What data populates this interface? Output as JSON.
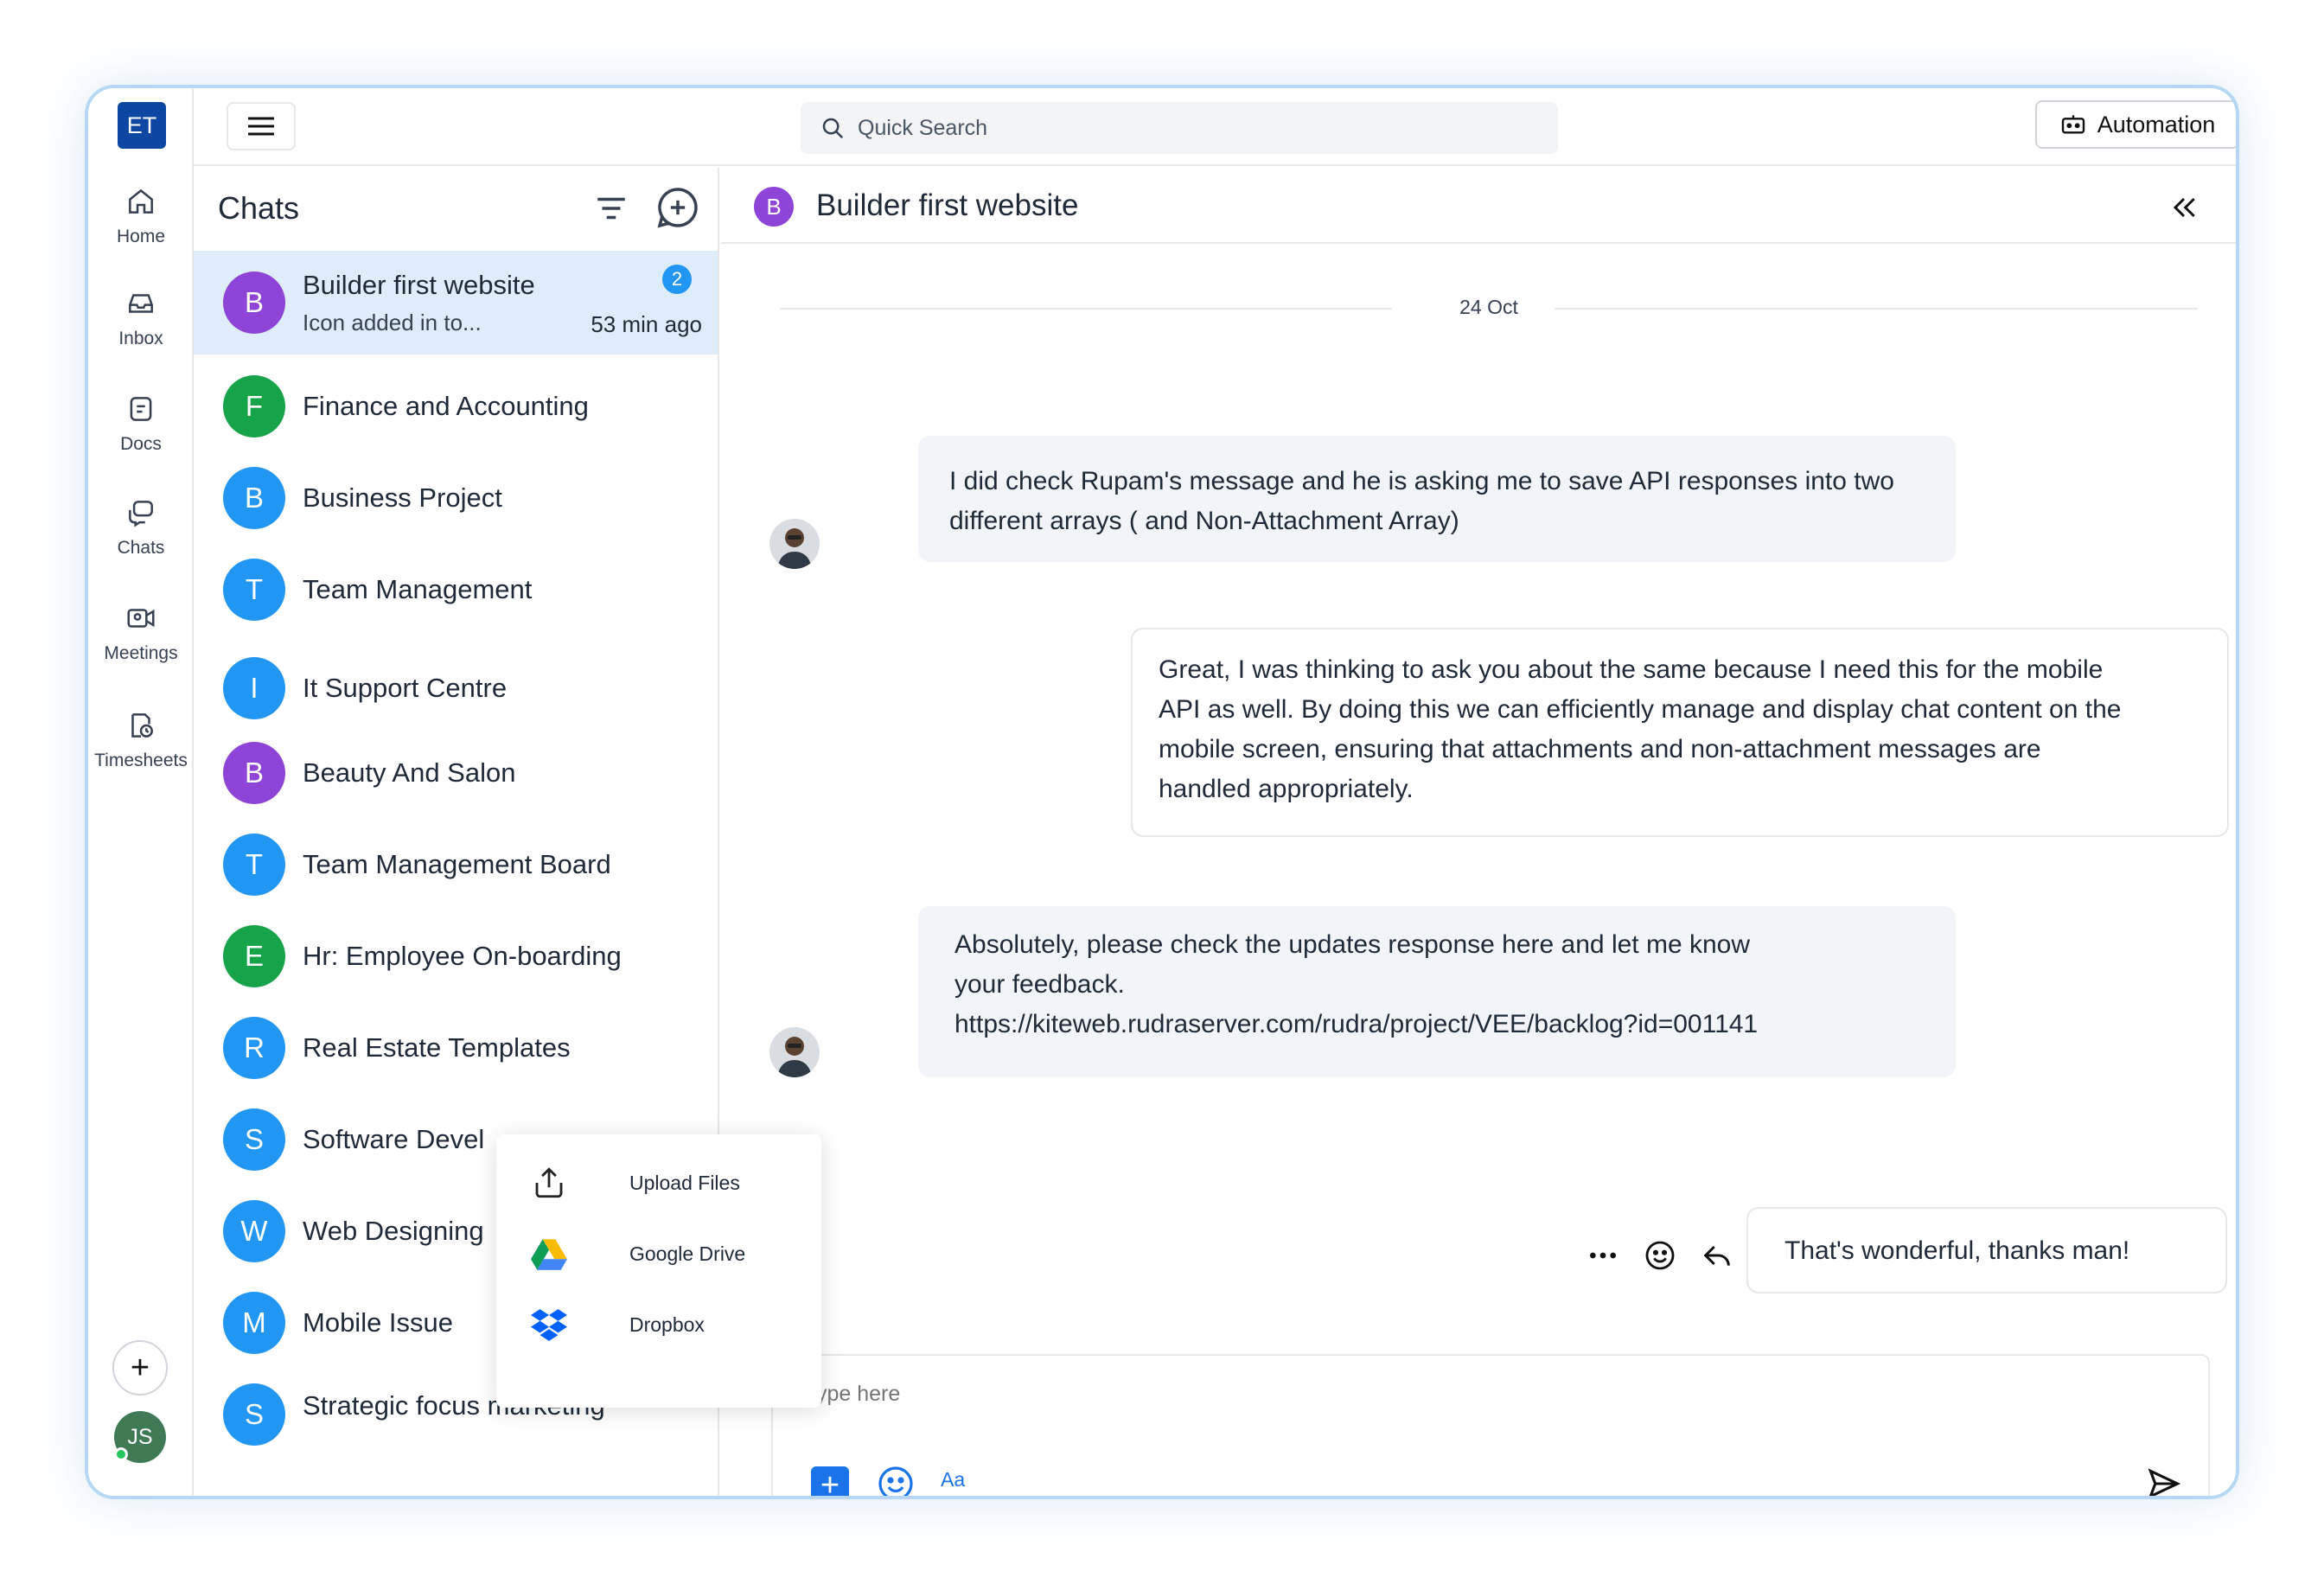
{
  "workspace": {
    "initials": "ET"
  },
  "rail": {
    "items": [
      {
        "label": "Home",
        "icon": "home-icon"
      },
      {
        "label": "Inbox",
        "icon": "inbox-icon"
      },
      {
        "label": "Docs",
        "icon": "docs-icon"
      },
      {
        "label": "Chats",
        "icon": "chats-icon"
      },
      {
        "label": "Meetings",
        "icon": "meetings-icon"
      },
      {
        "label": "Timesheets",
        "icon": "timesheets-icon"
      }
    ],
    "add_symbol": "+",
    "user_initials": "JS"
  },
  "topbar": {
    "search_placeholder": "Quick Search",
    "automation_label": "Automation"
  },
  "chats": {
    "title": "Chats",
    "items": [
      {
        "name": "Builder first website",
        "initial": "B",
        "color": "#8e44d6",
        "preview": "Icon added in to...",
        "time": "53 min ago",
        "unread": "2",
        "active": true
      },
      {
        "name": "Finance and Accounting",
        "initial": "F",
        "color": "#16a34a"
      },
      {
        "name": "Business Project",
        "initial": "B",
        "color": "#2196f3"
      },
      {
        "name": "Team Management",
        "initial": "T",
        "color": "#2196f3"
      },
      {
        "name": "It Support Centre",
        "initial": "I",
        "color": "#2196f3"
      },
      {
        "name": "Beauty And Salon",
        "initial": "B",
        "color": "#8e44d6"
      },
      {
        "name": "Team Management Board",
        "initial": "T",
        "color": "#2196f3"
      },
      {
        "name": "Hr: Employee On-boarding",
        "initial": "E",
        "color": "#16a34a"
      },
      {
        "name": "Real Estate Templates",
        "initial": "R",
        "color": "#2196f3"
      },
      {
        "name": "Software Devel",
        "initial": "S",
        "color": "#2196f3"
      },
      {
        "name": "Web Designing",
        "initial": "W",
        "color": "#2196f3"
      },
      {
        "name": "Mobile Issue",
        "initial": "M",
        "color": "#2196f3"
      },
      {
        "name": "Strategic focus marketing",
        "initial": "S",
        "color": "#2196f3"
      }
    ]
  },
  "attach_menu": {
    "items": [
      {
        "label": "Upload Files",
        "icon": "upload-icon"
      },
      {
        "label": "Google Drive",
        "icon": "google-drive-icon"
      },
      {
        "label": "Dropbox",
        "icon": "dropbox-icon"
      }
    ]
  },
  "conversation": {
    "title": "Builder first website",
    "initial": "B",
    "date_separator": "24 Oct",
    "messages": [
      {
        "direction": "in",
        "lines": [
          "I did check Rupam's message and he is asking me to save API responses into two",
          "different arrays (  and Non-Attachment Array)"
        ]
      },
      {
        "direction": "out",
        "lines": [
          "Great, I was thinking to ask you about the same because I need this for the mobile",
          "API as well. By doing this we can efficiently manage and display chat content on the",
          "mobile screen, ensuring that attachments and non-attachment messages are",
          "handled appropriately."
        ]
      },
      {
        "direction": "in",
        "lines": [
          "Absolutely, please check the updates response here and let me know",
          "your feedback.",
          "https://kiteweb.rudraserver.com/rudra/project/VEE/backlog?id=001141"
        ]
      },
      {
        "direction": "out",
        "lines": [
          "That's wonderful, thanks man!"
        ]
      }
    ],
    "composer": {
      "placeholder": "ype here",
      "format_label": "Aa",
      "plus_symbol": "+"
    }
  },
  "colors": {
    "accent": "#1a73e8",
    "active_chat_bg": "#deedf9",
    "workspace_logo": "#0d47a1",
    "badge": "#2196f3"
  }
}
